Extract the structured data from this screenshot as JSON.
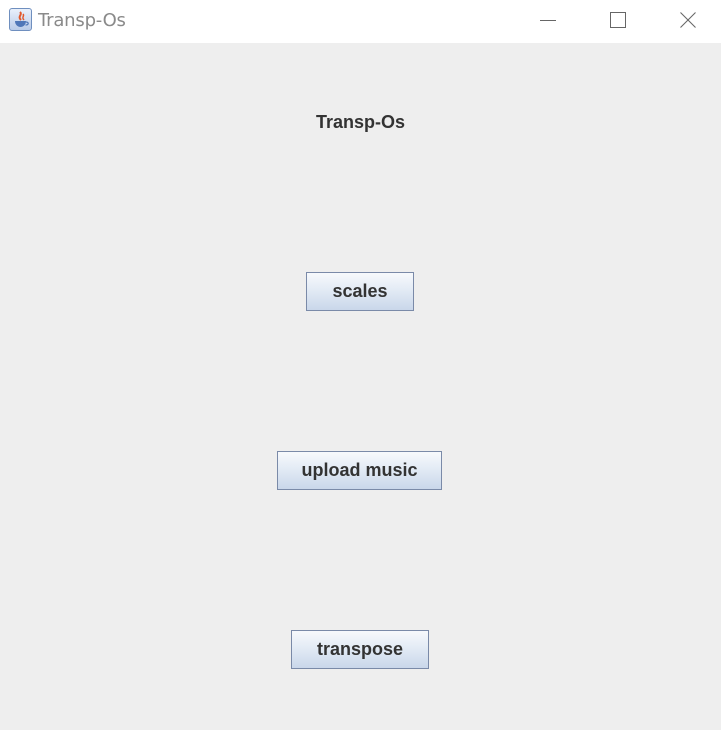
{
  "window": {
    "title": "Transp-Os",
    "icon": "java-cup-icon",
    "controls": [
      "minimize-icon",
      "maximize-icon",
      "close-icon"
    ]
  },
  "main": {
    "heading": "Transp-Os",
    "buttons": [
      {
        "label": "scales"
      },
      {
        "label": "upload music"
      },
      {
        "label": "transpose"
      }
    ]
  },
  "colors": {
    "content_background": "#eeeeee",
    "titlebar_background": "#ffffff",
    "button_border": "#7a8aa8",
    "text": "#333333"
  }
}
